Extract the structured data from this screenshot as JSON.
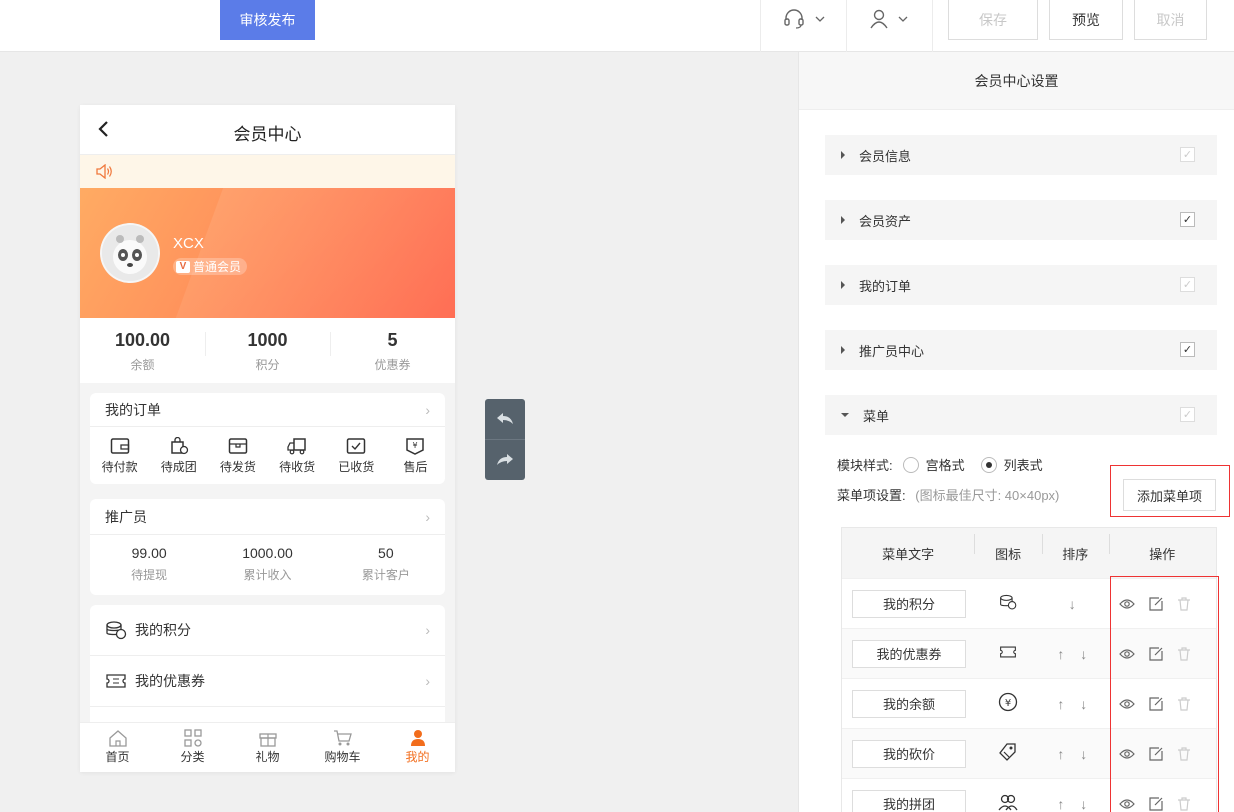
{
  "topbar": {
    "publish_label": "审核发布",
    "save_label": "保存",
    "preview_label": "预览",
    "cancel_label": "取消"
  },
  "phone": {
    "title": "会员中心",
    "user": {
      "name": "XCX",
      "level": "普通会员"
    },
    "stats": [
      {
        "value": "100.00",
        "label": "余额"
      },
      {
        "value": "1000",
        "label": "积分"
      },
      {
        "value": "5",
        "label": "优惠券"
      }
    ],
    "orders": {
      "title": "我的订单",
      "items": [
        "待付款",
        "待成团",
        "待发货",
        "待收货",
        "已收货",
        "售后"
      ]
    },
    "promoter": {
      "title": "推广员",
      "items": [
        {
          "value": "99.00",
          "label": "待提现"
        },
        {
          "value": "1000.00",
          "label": "累计收入"
        },
        {
          "value": "50",
          "label": "累计客户"
        }
      ]
    },
    "menu": [
      "我的积分",
      "我的优惠券"
    ],
    "tabs": [
      "首页",
      "分类",
      "礼物",
      "购物车",
      "我的"
    ]
  },
  "panel": {
    "title": "会员中心设置",
    "sections": [
      {
        "label": "会员信息",
        "checked": true,
        "disabled": true
      },
      {
        "label": "会员资产",
        "checked": true,
        "disabled": false
      },
      {
        "label": "我的订单",
        "checked": true,
        "disabled": true
      },
      {
        "label": "推广员中心",
        "checked": true,
        "disabled": false
      },
      {
        "label": "菜单",
        "checked": true,
        "disabled": true
      }
    ],
    "style_label": "模块样式:",
    "style_options": [
      "宫格式",
      "列表式"
    ],
    "style_selected": "列表式",
    "setting_label": "菜单项设置:",
    "setting_hint": "(图标最佳尺寸: 40×40px)",
    "add_label": "添加菜单项",
    "table_headers": [
      "菜单文字",
      "图标",
      "排序",
      "操作"
    ],
    "rows": [
      {
        "name": "我的积分",
        "icon": "coins-icon",
        "sort": "↓"
      },
      {
        "name": "我的优惠券",
        "icon": "ticket-icon",
        "sort": "↑ ↓"
      },
      {
        "name": "我的余额",
        "icon": "balance-icon",
        "sort": "↑ ↓"
      },
      {
        "name": "我的砍价",
        "icon": "bargain-icon",
        "sort": "↑ ↓"
      },
      {
        "name": "我的拼团",
        "icon": "group-icon",
        "sort": "↑ ↓"
      }
    ]
  }
}
